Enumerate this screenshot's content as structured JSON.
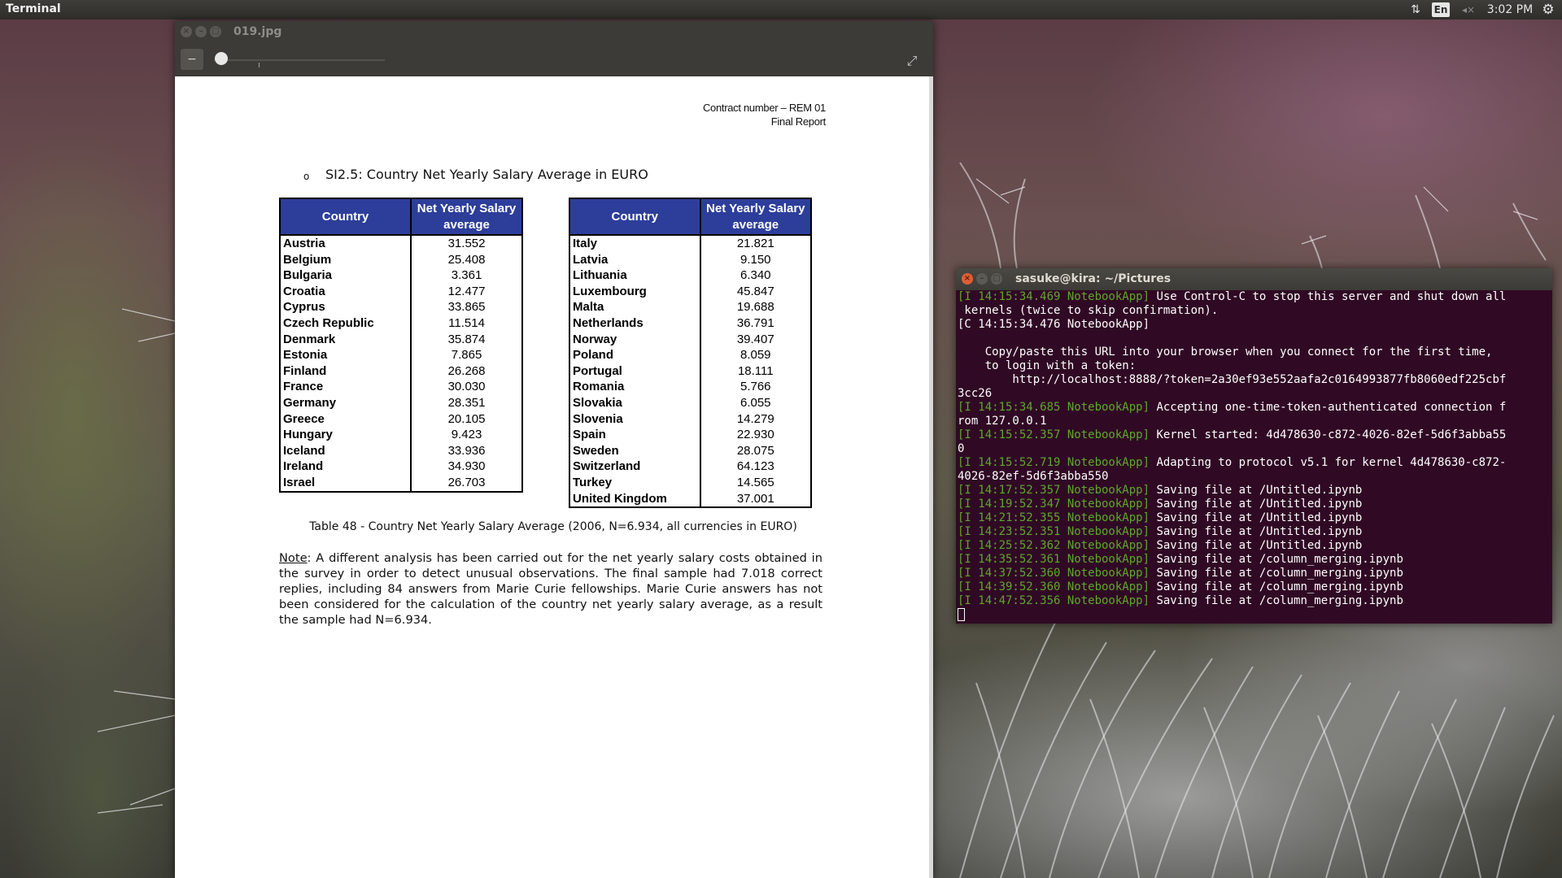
{
  "top_panel": {
    "app_title": "Terminal",
    "keyboard_layout": "En",
    "sound_label": "◂×",
    "clock": "3:02 PM",
    "icons": [
      "network-updown-icon",
      "keyboard-layout-icon",
      "sound-muted-icon",
      "gear-icon"
    ]
  },
  "viewer": {
    "title": "019.jpg",
    "zoom_out_label": "−",
    "fullscreen_label": "⤢",
    "document": {
      "header_line1": "Contract number – REM 01",
      "header_line2": "Final Report",
      "bullet": "o",
      "section_title": "SI2.5: Country Net Yearly Salary Average in EURO",
      "table_headers": {
        "country": "Country",
        "salary": "Net Yearly Salary average"
      },
      "left_table": [
        {
          "country": "Austria",
          "value": "31.552"
        },
        {
          "country": "Belgium",
          "value": "25.408"
        },
        {
          "country": "Bulgaria",
          "value": "3.361"
        },
        {
          "country": "Croatia",
          "value": "12.477"
        },
        {
          "country": "Cyprus",
          "value": "33.865"
        },
        {
          "country": "Czech Republic",
          "value": "11.514"
        },
        {
          "country": "Denmark",
          "value": "35.874"
        },
        {
          "country": "Estonia",
          "value": "7.865"
        },
        {
          "country": "Finland",
          "value": "26.268"
        },
        {
          "country": "France",
          "value": "30.030"
        },
        {
          "country": "Germany",
          "value": "28.351"
        },
        {
          "country": "Greece",
          "value": "20.105"
        },
        {
          "country": "Hungary",
          "value": "9.423"
        },
        {
          "country": "Iceland",
          "value": "33.936"
        },
        {
          "country": "Ireland",
          "value": "34.930"
        },
        {
          "country": "Israel",
          "value": "26.703"
        }
      ],
      "right_table": [
        {
          "country": "Italy",
          "value": "21.821"
        },
        {
          "country": "Latvia",
          "value": "9.150"
        },
        {
          "country": "Lithuania",
          "value": "6.340"
        },
        {
          "country": "Luxembourg",
          "value": "45.847"
        },
        {
          "country": "Malta",
          "value": "19.688"
        },
        {
          "country": "Netherlands",
          "value": "36.791"
        },
        {
          "country": "Norway",
          "value": "39.407"
        },
        {
          "country": "Poland",
          "value": "8.059"
        },
        {
          "country": "Portugal",
          "value": "18.111"
        },
        {
          "country": "Romania",
          "value": "5.766"
        },
        {
          "country": "Slovakia",
          "value": "6.055"
        },
        {
          "country": "Slovenia",
          "value": "14.279"
        },
        {
          "country": "Spain",
          "value": "22.930"
        },
        {
          "country": "Sweden",
          "value": "28.075"
        },
        {
          "country": "Switzerland",
          "value": "64.123"
        },
        {
          "country": "Turkey",
          "value": "14.565"
        },
        {
          "country": "United Kingdom",
          "value": "37.001"
        }
      ],
      "caption": "Table 48 - Country Net Yearly Salary Average (2006, N=6.934, all currencies in EURO)",
      "note_label": "Note",
      "note_text": ": A different analysis has been carried out for the net yearly salary costs obtained in the survey in order to detect unusual observations. The final sample had 7.018 correct replies, including 84 answers from Marie Curie fellowships. Marie Curie answers has not been considered for the calculation of the country net yearly salary average, as a result the sample had N=6.934."
    }
  },
  "terminal": {
    "title": "sasuke@kira: ~/Pictures",
    "lines": [
      {
        "tag": "[I 14:15:34.469 NotebookApp]",
        "text": " Use Control-C to stop this server and shut down all"
      },
      {
        "tag": "",
        "text": " kernels (twice to skip confirmation)."
      },
      {
        "tag": "",
        "text": "[C 14:15:34.476 NotebookApp]"
      },
      {
        "tag": "",
        "text": ""
      },
      {
        "tag": "",
        "text": "    Copy/paste this URL into your browser when you connect for the first time,"
      },
      {
        "tag": "",
        "text": "    to login with a token:"
      },
      {
        "tag": "",
        "text": "        http://localhost:8888/?token=2a30ef93e552aafa2c0164993877fb8060edf225cbf"
      },
      {
        "tag": "",
        "text": "3cc26"
      },
      {
        "tag": "[I 14:15:34.685 NotebookApp]",
        "text": " Accepting one-time-token-authenticated connection f"
      },
      {
        "tag": "",
        "text": "rom 127.0.0.1"
      },
      {
        "tag": "[I 14:15:52.357 NotebookApp]",
        "text": " Kernel started: 4d478630-c872-4026-82ef-5d6f3abba55"
      },
      {
        "tag": "",
        "text": "0"
      },
      {
        "tag": "[I 14:15:52.719 NotebookApp]",
        "text": " Adapting to protocol v5.1 for kernel 4d478630-c872-"
      },
      {
        "tag": "",
        "text": "4026-82ef-5d6f3abba550"
      },
      {
        "tag": "[I 14:17:52.357 NotebookApp]",
        "text": " Saving file at /Untitled.ipynb"
      },
      {
        "tag": "[I 14:19:52.347 NotebookApp]",
        "text": " Saving file at /Untitled.ipynb"
      },
      {
        "tag": "[I 14:21:52.355 NotebookApp]",
        "text": " Saving file at /Untitled.ipynb"
      },
      {
        "tag": "[I 14:23:52.351 NotebookApp]",
        "text": " Saving file at /Untitled.ipynb"
      },
      {
        "tag": "[I 14:25:52.362 NotebookApp]",
        "text": " Saving file at /Untitled.ipynb"
      },
      {
        "tag": "[I 14:35:52.361 NotebookApp]",
        "text": " Saving file at /column_merging.ipynb"
      },
      {
        "tag": "[I 14:37:52.360 NotebookApp]",
        "text": " Saving file at /column_merging.ipynb"
      },
      {
        "tag": "[I 14:39:52.360 NotebookApp]",
        "text": " Saving file at /column_merging.ipynb"
      },
      {
        "tag": "[I 14:47:52.356 NotebookApp]",
        "text": " Saving file at /column_merging.ipynb"
      }
    ]
  },
  "colors": {
    "panel_bg": "#3c3b37",
    "terminal_bg": "#300a24",
    "terminal_tag": "#5fa62f",
    "table_header_bg": "#2d3e9a",
    "close_button": "#e25d33"
  }
}
